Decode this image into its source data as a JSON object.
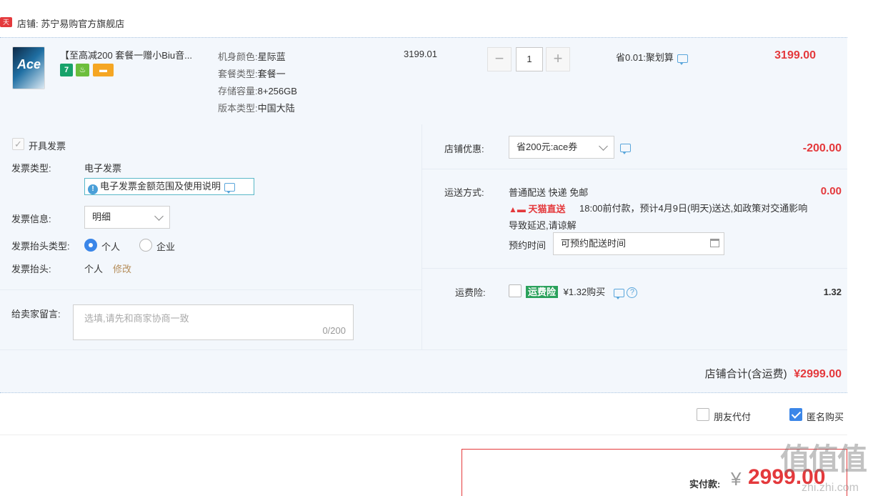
{
  "shop": {
    "badge": "天猫",
    "name": "店铺: 苏宁易购官方旗舰店"
  },
  "item": {
    "thumb_text": "Ace",
    "title": "【至高减200 套餐一赠小Biu音...",
    "service_icons": [
      "7",
      "♨",
      "▬"
    ],
    "attrs": [
      {
        "label": "机身颜色:",
        "value": "星际蓝"
      },
      {
        "label": "套餐类型:",
        "value": "套餐一"
      },
      {
        "label": "存储容量:",
        "value": "8+256GB"
      },
      {
        "label": "版本类型:",
        "value": "中国大陆"
      }
    ],
    "unit_price": "3199.01",
    "qty_minus": "−",
    "qty": "1",
    "qty_plus": "+",
    "promo": "省0.01:聚划算",
    "subtotal": "3199.00"
  },
  "invoice": {
    "toggle_label": "开具发票",
    "type_label": "发票类型:",
    "type_value": "电子发票",
    "info_link": "电子发票金额范围及使用说明",
    "info_label": "发票信息:",
    "info_select": "明细",
    "title_type_label": "发票抬头类型:",
    "opt_personal": "个人",
    "opt_company": "企业",
    "title_label": "发票抬头:",
    "title_value": "个人",
    "edit_link": "修改"
  },
  "message": {
    "label": "给卖家留言:",
    "placeholder": "选填,请先和商家协商一致",
    "counter": "0/200"
  },
  "discount": {
    "label": "店铺优惠:",
    "value": "省200元:ace券",
    "amount": "-200.00"
  },
  "shipping": {
    "label": "运送方式:",
    "method": "普通配送 快递 免邮",
    "amount": "0.00",
    "tmall_direct": "天猫直送",
    "note_line1": "18:00前付款，预计4月9日(明天)送达,如政策对交通影响",
    "note_line2": "导致延迟,请谅解",
    "appt_label": "预约时间",
    "appt_value": "可预约配送时间"
  },
  "insurance": {
    "label": "运费险:",
    "tag": "运费险",
    "desc": "¥1.32购买",
    "amount": "1.32",
    "help": "?"
  },
  "total": {
    "label": "店铺合计(含运费)",
    "value": "¥2999.00"
  },
  "options": {
    "friend_pay": "朋友代付",
    "anonymous": "匿名购买"
  },
  "payment": {
    "label": "实付款:",
    "currency": "¥",
    "value": "2999.00"
  },
  "watermark": {
    "logo": "值值值",
    "sub": "zhi.zhi.com"
  },
  "colors": {
    "accent_red": "#e4393c",
    "panel_bg": "#f3f7fc",
    "link_blue": "#3b86e8"
  }
}
